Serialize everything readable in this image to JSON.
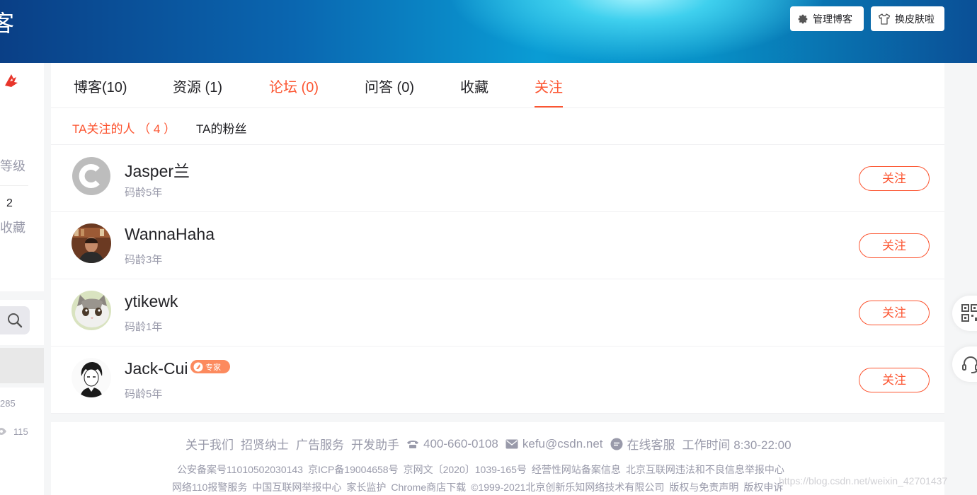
{
  "banner": {
    "title": "客",
    "manage_label": "管理博客",
    "skin_label": "换皮肤啦"
  },
  "sidebar": {
    "level_label": "等级",
    "favorites_count": "2",
    "favorites_label": "收藏",
    "stat1": "285",
    "stat2": "115"
  },
  "tabs": [
    {
      "label": "博客(10)",
      "color": "#222226"
    },
    {
      "label": "资源 (1)",
      "color": "#222226"
    },
    {
      "label": "论坛 (0)",
      "color": "#fc5531"
    },
    {
      "label": "问答 (0)",
      "color": "#222226"
    },
    {
      "label": "收藏",
      "color": "#222226"
    },
    {
      "label": "关注",
      "color": "#fc5531"
    }
  ],
  "subtabs": {
    "following": "TA关注的人 （ 4 ）",
    "fans": "TA的粉丝"
  },
  "users": [
    {
      "name": "Jasper兰",
      "age": "码龄5年",
      "follow_label": "关注"
    },
    {
      "name": "WannaHaha",
      "age": "码龄3年",
      "follow_label": "关注"
    },
    {
      "name": "ytikewk",
      "age": "码龄1年",
      "follow_label": "关注"
    },
    {
      "name": "Jack-Cui",
      "age": "码龄5年",
      "follow_label": "关注",
      "badge": "专家"
    }
  ],
  "footer": {
    "about": "关于我们",
    "jobs": "招贤纳士",
    "ads": "广告服务",
    "dev": "开发助手",
    "phone": "400-660-0108",
    "email": "kefu@csdn.net",
    "online": "在线客服",
    "hours": "工作时间 8:30-22:00",
    "line2": [
      "公安备案号11010502030143",
      "京ICP备19004658号",
      "京网文〔2020〕1039-165号",
      "经营性网站备案信息",
      "北京互联网违法和不良信息举报中心"
    ],
    "line3": [
      "网络110报警服务",
      "中国互联网举报中心",
      "家长监护",
      "Chrome商店下载",
      "©1999-2021北京创新乐知网络技术有限公司",
      "版权与免责声明",
      "版权申诉"
    ]
  },
  "watermark": "https://blog.csdn.net/weixin_42701437",
  "colors": {
    "accent": "#fc5531",
    "text": "#222226",
    "muted": "#999aaa"
  }
}
